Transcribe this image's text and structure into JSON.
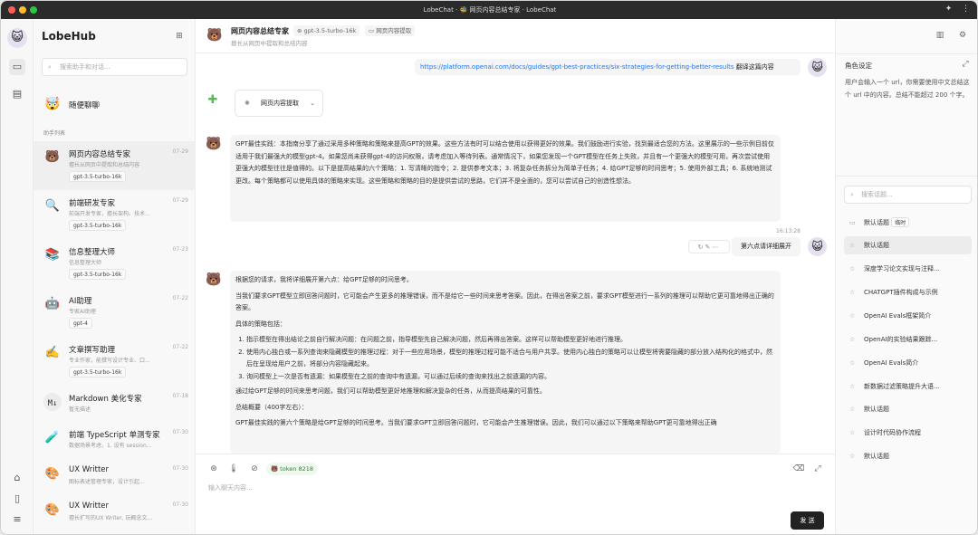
{
  "window": {
    "title": "LobeChat · 🐝 网页内容总结专家 · LobeChat"
  },
  "colors": {
    "accent": "#1f1f1f",
    "link": "#1677ff",
    "tag_bg": "#fafafa",
    "send_bg": "#222222"
  },
  "rail": {
    "icons": [
      "avatar",
      "chat-icon",
      "file-icon",
      "discord-icon",
      "mobile-icon",
      "settings-icon"
    ]
  },
  "sidebar": {
    "brand": "LobeHub",
    "search_placeholder": "搜索助手和对话...",
    "random_chat": "随便聊聊",
    "section_label": "助手列表",
    "agents": [
      {
        "title": "网页内容总结专家",
        "desc": "擅长从网页中提取和总结内容",
        "date": "07-29",
        "tag": "gpt-3.5-turbo-16k",
        "emoji": "🐻"
      },
      {
        "title": "前端研发专家",
        "desc": "前端开发专家，擅长架构、技术...",
        "date": "07-29",
        "tag": "gpt-3.5-turbo-16k",
        "emoji": "🔍"
      },
      {
        "title": "信息整理大师",
        "desc": "信息整理大师",
        "date": "07-23",
        "tag": "gpt-3.5-turbo-16k",
        "emoji": "📚"
      },
      {
        "title": "AI助理",
        "desc": "专家AI助理",
        "date": "07-22",
        "tag": "gpt-4",
        "emoji": "🤖"
      },
      {
        "title": "文章撰写助理",
        "desc": "专业作家，能撰写设计专业、口...",
        "date": "07-22",
        "tag": "gpt-3.5-turbo-16k",
        "emoji": "✍️"
      },
      {
        "title": "Markdown 美化专家",
        "desc": "暂无描述",
        "date": "07-18",
        "tag": "",
        "emoji": ""
      },
      {
        "title": "前端 TypeScript 单测专家",
        "desc": "数据场景考虑，1. 设有 session...",
        "date": "07-30",
        "tag": "",
        "emoji": "🧪"
      },
      {
        "title": "UX Writter",
        "desc": "图标表述管理专家，设计引起...",
        "date": "07-30",
        "tag": "",
        "emoji": "🎨"
      },
      {
        "title": "UX Writter",
        "desc": "擅长扩写的UX Writer, 玩概念文...",
        "date": "07-30",
        "tag": "",
        "emoji": "🎨"
      }
    ]
  },
  "header": {
    "title": "网页内容总结专家",
    "model_tag": "gpt-3.5-turbo-16k",
    "plugin_tag": "网页内容提取",
    "subtitle": "擅长从网页中提取和总结内容"
  },
  "chat": {
    "user_msg1": "https://platform.openai.com/docs/guides/gpt-best-practices/six-strategies-for-getting-better-results",
    "user_msg1_suffix": "翻译这篇内容",
    "plugin_chip": "网页内容提取",
    "assistant1": "GPT最佳实践：本指南分享了通过采用多种策略和策略来提高GPT的效果。这些方法有时可以结合使用以获得更好的效果。我们鼓励进行实验，找到最适合您的方法。这里展示的一些示例目前仅适用于我们最强大的模型gpt-4。如果您尚未获得gpt-4的访问权限，请考虑加入等待列表。通常情况下，如果您发现一个GPT模型在任务上失败，并且有一个更强大的模型可用，再次尝试使用更强大的模型往往是值得的。以下是提高结果的六个策略：1. 写清晰的指令；2. 提供参考文本；3. 将复杂任务拆分为简单子任务；4. 给GPT足够的时间思考；5. 使用外部工具；6. 系统地测试更改。每个策略都可以使用具体的策略来实现。这些策略和策略的目的是提供尝试的思路，它们并不是全面的，您可以尝试自己的创造性想法。",
    "timestamp": "16:13:28",
    "user_msg2": "第六点请详细展开",
    "a2_intro": "根据您的请求，我将详细展开第六点：给GPT足够的时间思考。",
    "a2_p1": "当我们要求GPT模型立即回答问题时，它可能会产生更多的推理错误，而不是给它一些时间来思考答案。因此，在得出答案之前，要求GPT模型进行一系列的推理可以帮助它更可靠地得出正确的答案。",
    "a2_strategies_title": "具体的策略包括：",
    "a2_items": [
      "指示模型在得出结论之前自行解决问题：在问题之前，指导模型先自己解决问题，然后再得出答案。这样可以帮助模型更好地进行推理。",
      "使用内心独白或一系列查询来隐藏模型的推理过程：对于一些应用场景，模型的推理过程可能不适合与用户共享。使用内心独白的策略可以让模型将需要隐藏的部分放入结构化的格式中，然后在呈现给用户之前，将部分内容隐藏起来。",
      "询问模型上一次是否有遗漏：如果模型在之前的查询中有遗漏，可以通过后续的查询来找出之前遗漏的内容。"
    ],
    "a2_p2": "通过给GPT足够的时间来思考问题，我们可以帮助模型更好地推理和解决复杂的任务，从而提高结果的可靠性。",
    "a2_summary_title": "总结概要（400字左右）：",
    "a2_summary": "GPT最佳实践的第六个策略是给GPT足够的时间思考。当我们要求GPT立即回答问题时，它可能会产生推理错误。因此，我们可以通过以下策略来帮助GPT更可靠地得出正确"
  },
  "input": {
    "placeholder": "输入聊天内容...",
    "token_label": "token",
    "token_count": "8218",
    "send_label": "发 送"
  },
  "right": {
    "role_title": "角色设定",
    "role_text": "用户会输入一个 url，你需要使用中文总结这个 url 中的内容。总结不能超过 200 个字。",
    "topic_search_placeholder": "搜索话题...",
    "topics": [
      {
        "label": "默认话题",
        "badge": "临时",
        "icon": "chat-icon"
      },
      {
        "label": "默认话题",
        "badge": "",
        "icon": "star-icon"
      },
      {
        "label": "深度学习论文实现与注释...",
        "badge": "",
        "icon": "star-icon"
      },
      {
        "label": "CHATGPT插件构成与示例",
        "badge": "",
        "icon": "star-icon"
      },
      {
        "label": "OpenAI Evals框架简介",
        "badge": "",
        "icon": "star-icon"
      },
      {
        "label": "OpenAI的实验结果跟踪...",
        "badge": "",
        "icon": "star-icon"
      },
      {
        "label": "OpenAI Evals简介",
        "badge": "",
        "icon": "star-icon"
      },
      {
        "label": "新数据过滤策略提升大语...",
        "badge": "",
        "icon": "star-icon"
      },
      {
        "label": "默认话题",
        "badge": "",
        "icon": "star-icon"
      },
      {
        "label": "设计时代码协作流程",
        "badge": "",
        "icon": "star-icon"
      },
      {
        "label": "默认话题",
        "badge": "",
        "icon": "star-icon"
      }
    ]
  }
}
